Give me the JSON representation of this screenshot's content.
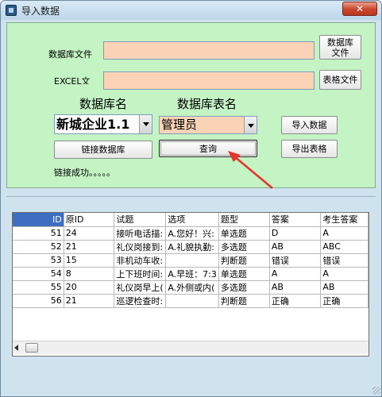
{
  "window": {
    "title": "导入数据",
    "close_glyph": "✕"
  },
  "form": {
    "db_file_label": "数据库文件",
    "excel_label": "EXCEL文",
    "db_name_label": "数据库名",
    "table_name_label": "数据库表名",
    "db_file_value": "",
    "excel_file_value": "",
    "db_name_selected": "新城企业1.1",
    "table_name_selected": "管理员",
    "status": "链接成功。。。。。"
  },
  "buttons": {
    "db_file": "数据库\n文件",
    "excel_file": "表格文件",
    "import": "导入数据",
    "connect": "链接数据库",
    "query": "查询",
    "export": "导出表格"
  },
  "grid": {
    "columns": [
      "ID",
      "原ID",
      "试题",
      "选项",
      "题型",
      "答案",
      "考生答案"
    ],
    "rows": [
      [
        "51",
        "24",
        "接听电话描:",
        "A.您好！兴:",
        "单选题",
        "D",
        "A"
      ],
      [
        "52",
        "21",
        "礼仪岗接到:",
        "A.礼貌执勤:",
        "多选题",
        "AB",
        "ABC"
      ],
      [
        "53",
        "15",
        "非机动车收:",
        "",
        "判断题",
        "错误",
        "错误"
      ],
      [
        "54",
        "8",
        "上下班时间:",
        "A.早班：7:3",
        "单选题",
        "A",
        "A"
      ],
      [
        "55",
        "20",
        "礼仪岗早上(",
        "A.外侧或内(",
        "多选题",
        "AB",
        "AB"
      ],
      [
        "56",
        "21",
        "巡逻检查时:",
        "",
        "判断题",
        "正确",
        "正确"
      ]
    ]
  },
  "colors": {
    "panel": "#c4f3c4",
    "field": "#fad3b6",
    "selected_header": "#3e6dc2",
    "annotation_arrow": "#e8322c"
  }
}
